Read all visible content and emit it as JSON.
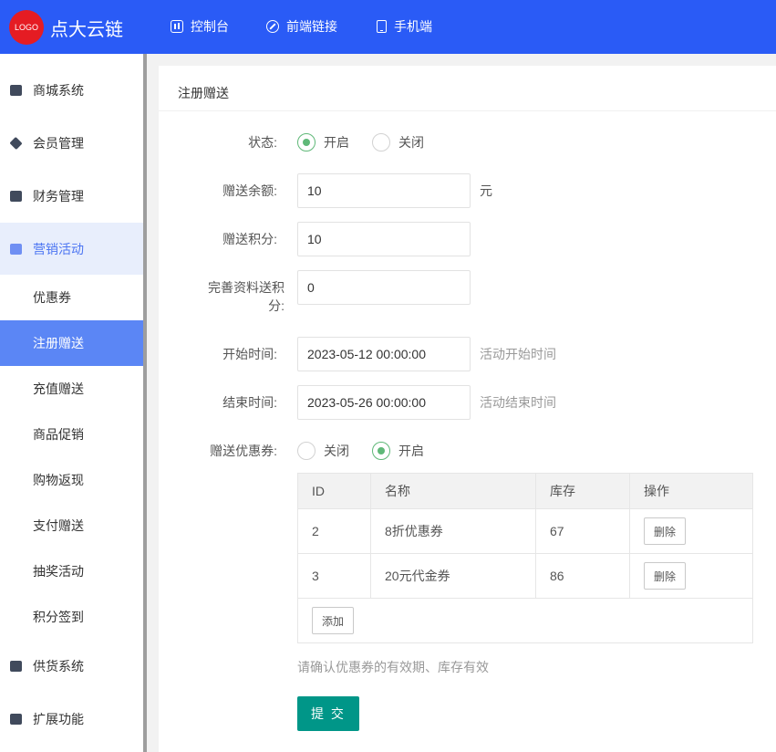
{
  "header": {
    "logo_text": "LOGO",
    "brand": "点大云链",
    "nav": [
      {
        "label": "控制台",
        "icon": "dashboard-icon"
      },
      {
        "label": "前端链接",
        "icon": "link-icon"
      },
      {
        "label": "手机端",
        "icon": "phone-icon"
      }
    ]
  },
  "sidebar": {
    "menu": [
      {
        "label": "商城系统",
        "icon": "shop-bag-icon"
      },
      {
        "label": "会员管理",
        "icon": "diamond-icon"
      },
      {
        "label": "财务管理",
        "icon": "finance-icon"
      },
      {
        "label": "营销活动",
        "icon": "gift-icon"
      }
    ],
    "sub": [
      "优惠券",
      "注册赠送",
      "充值赠送",
      "商品促销",
      "购物返现",
      "支付赠送",
      "抽奖活动",
      "积分签到"
    ],
    "menu_bottom": [
      {
        "label": "供货系统",
        "icon": "truck-icon"
      },
      {
        "label": "扩展功能",
        "icon": "puzzle-icon"
      }
    ]
  },
  "panel": {
    "title": "注册赠送",
    "status": {
      "label": "状态:",
      "options": [
        "开启",
        "关闭"
      ],
      "selected": "开启"
    },
    "balance": {
      "label": "赠送余额:",
      "value": "10",
      "unit": "元"
    },
    "points": {
      "label": "赠送积分:",
      "value": "10"
    },
    "profile_points": {
      "label": "完善资料送积分:",
      "value": "0"
    },
    "start_time": {
      "label": "开始时间:",
      "value": "2023-05-12 00:00:00",
      "hint": "活动开始时间"
    },
    "end_time": {
      "label": "结束时间:",
      "value": "2023-05-26 00:00:00",
      "hint": "活动结束时间"
    },
    "coupon": {
      "label": "赠送优惠券:",
      "options": [
        "关闭",
        "开启"
      ],
      "selected": "开启"
    },
    "table": {
      "headers": [
        "ID",
        "名称",
        "库存",
        "操作"
      ],
      "rows": [
        {
          "id": "2",
          "name": "8折优惠券",
          "stock": "67",
          "action": "删除"
        },
        {
          "id": "3",
          "name": "20元代金券",
          "stock": "86",
          "action": "删除"
        }
      ],
      "add_label": "添加"
    },
    "hint": "请确认优惠券的有效期、库存有效",
    "submit": "提 交"
  }
}
